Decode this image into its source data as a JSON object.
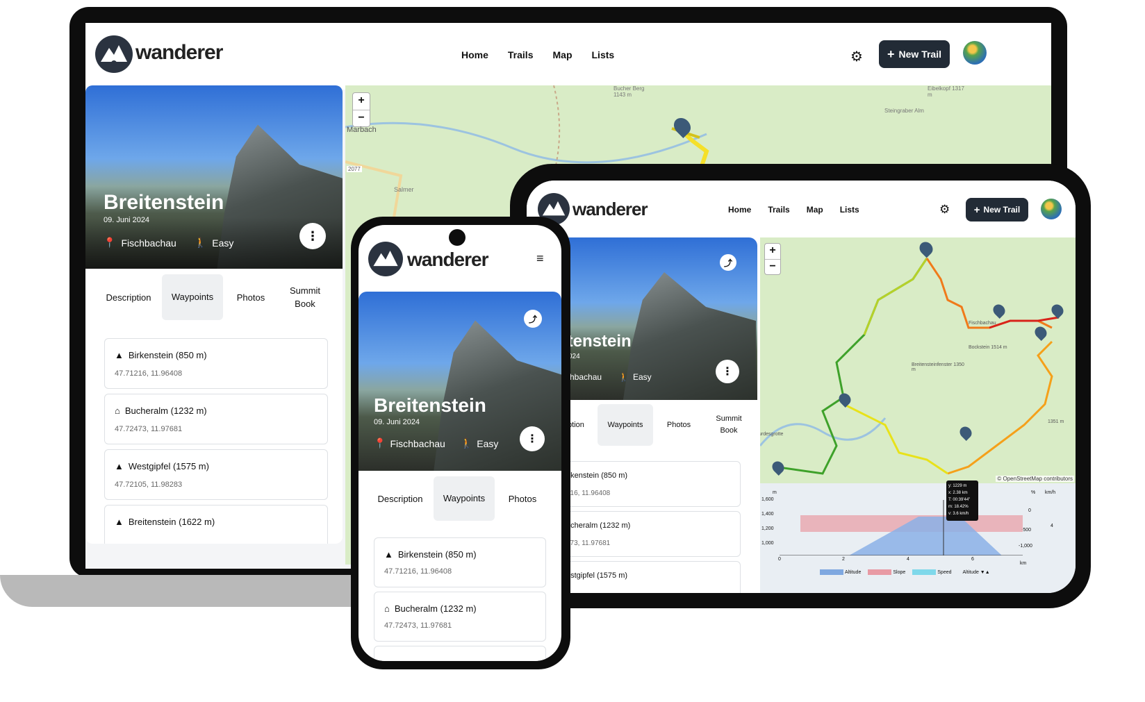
{
  "app": {
    "name": "wanderer"
  },
  "nav": {
    "home": "Home",
    "trails": "Trails",
    "map": "Map",
    "lists": "Lists",
    "new_trail": "New Trail"
  },
  "trail": {
    "title": "Breitenstein",
    "date": "09. Juni 2024",
    "location": "Fischbachau",
    "difficulty": "Easy"
  },
  "tabs": {
    "description": "Description",
    "waypoints": "Waypoints",
    "photos": "Photos",
    "summit_book": "Summit Book",
    "summit_line1": "Summit",
    "summit_line2": "Book"
  },
  "waypoints": [
    {
      "name": "Birkenstein (850 m)",
      "coords": "47.71216, 11.96408",
      "icon": "mountain-icon"
    },
    {
      "name": "Bucheralm (1232 m)",
      "coords": "47.72473, 11.97681",
      "icon": "home-icon"
    },
    {
      "name": "Westgipfel (1575 m)",
      "coords": "47.72105, 11.98283",
      "icon": "mountain-icon"
    },
    {
      "name": "Breitenstein (1622 m)",
      "coords": "",
      "icon": "mountain-icon"
    }
  ],
  "tablet_waypoints": [
    {
      "name": "irkenstein (850 m)",
      "coords": "216, 11.96408"
    },
    {
      "name": "ucheralm (1232 m)",
      "coords": "473, 11.97681"
    },
    {
      "name": "estgipfel (1575 m)"
    }
  ],
  "tablet_hero": {
    "title": "itenstein",
    "date": "024",
    "location": "chbachau",
    "tab_cut": "ption"
  },
  "map": {
    "zoom_in": "+",
    "zoom_out": "−",
    "attribution": "© OpenStreetMap contributors",
    "labels": [
      "Marbach",
      "Salmer",
      "Bucher Berg 1143 m",
      "Eibelkopf 1317 m",
      "Steingraber Alm",
      "2077",
      "Fischbachau",
      "Bockstein 1514 m",
      "Breitensteinfenster 1350 m",
      "1351 m",
      "urdesgrotte"
    ]
  },
  "elevation_chart": {
    "type": "line",
    "xlabel": "km",
    "ylabel": "m",
    "y2label": "%",
    "y3label": "km/h",
    "y_ticks": [
      "1,600",
      "1,400",
      "1,200",
      "1,000"
    ],
    "x_ticks": [
      "0",
      "2",
      "4",
      "6"
    ],
    "y2_ticks": [
      "0",
      "-500",
      "-1,000"
    ],
    "y3_ticks": [
      "4"
    ],
    "legend": [
      "Altitude",
      "Slope",
      "Speed"
    ],
    "legend_colors": [
      "#7fa8e0",
      "#e89aa4",
      "#7fd8ea"
    ],
    "select": "Altitude ▼▲",
    "tooltip": [
      "y: 1229 m",
      "x: 2.38 km",
      "T: 00:39'44\"",
      "m: 18.42%",
      "v: 3.6 km/h"
    ]
  },
  "colors": {
    "dark": "#222b36",
    "accent": "#2b3340",
    "map_green": "#d9ecc6"
  }
}
